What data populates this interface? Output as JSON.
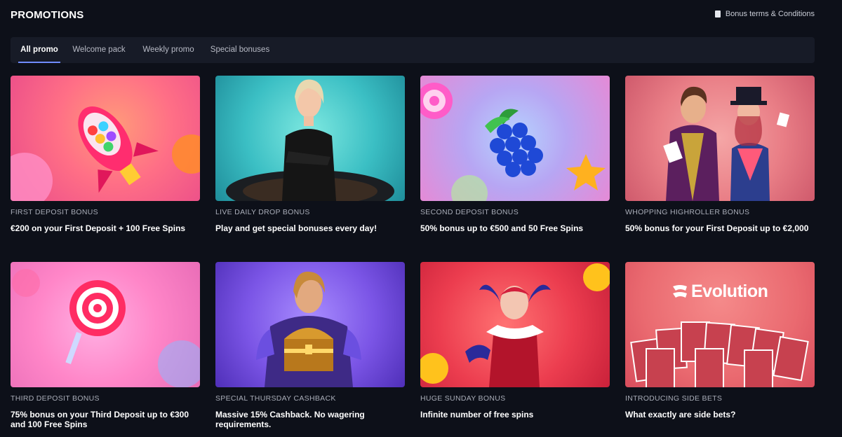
{
  "header": {
    "title": "PROMOTIONS",
    "terms_label": "Bonus terms & Conditions"
  },
  "tabs": [
    {
      "label": "All promo",
      "active": true
    },
    {
      "label": "Welcome pack",
      "active": false
    },
    {
      "label": "Weekly promo",
      "active": false
    },
    {
      "label": "Special bonuses",
      "active": false
    }
  ],
  "colors": {
    "accent": "#6f8cff",
    "background": "#0d1019",
    "tabs_bar": "#171b27"
  },
  "promotions": [
    {
      "category": "FIRST DEPOSIT BONUS",
      "description": "€200 on your First Deposit + 100 Free Spins",
      "image": "rocket-gumball-illustration"
    },
    {
      "category": "LIVE DAILY DROP BONUS",
      "description": "Play and get special bonuses every day!",
      "image": "live-dealer-roulette-photo"
    },
    {
      "category": "SECOND DEPOSIT BONUS",
      "description": "50% bonus up to €500 and 50 Free Spins",
      "image": "grapes-candy-star-illustration"
    },
    {
      "category": "WHOPPING HIGHROLLER BONUS",
      "description": "50% bonus for your First Deposit up to €2,000",
      "image": "magician-couple-cards-illustration"
    },
    {
      "category": "THIRD DEPOSIT BONUS",
      "description": "75% bonus on your Third Deposit up to €300 and 100 Free Spins",
      "image": "lollipop-illustration"
    },
    {
      "category": "SPECIAL THURSDAY CASHBACK",
      "description": "Massive 15% Cashback. No wagering requirements.",
      "image": "warrior-treasure-chest-illustration"
    },
    {
      "category": "HUGE SUNDAY BONUS",
      "description": "Infinite number of free spins",
      "image": "jester-girl-illustration"
    },
    {
      "category": "INTRODUCING SIDE BETS",
      "description": "What exactly are side bets?",
      "image": "evolution-playing-cards",
      "logo_text": "Evolution"
    }
  ]
}
